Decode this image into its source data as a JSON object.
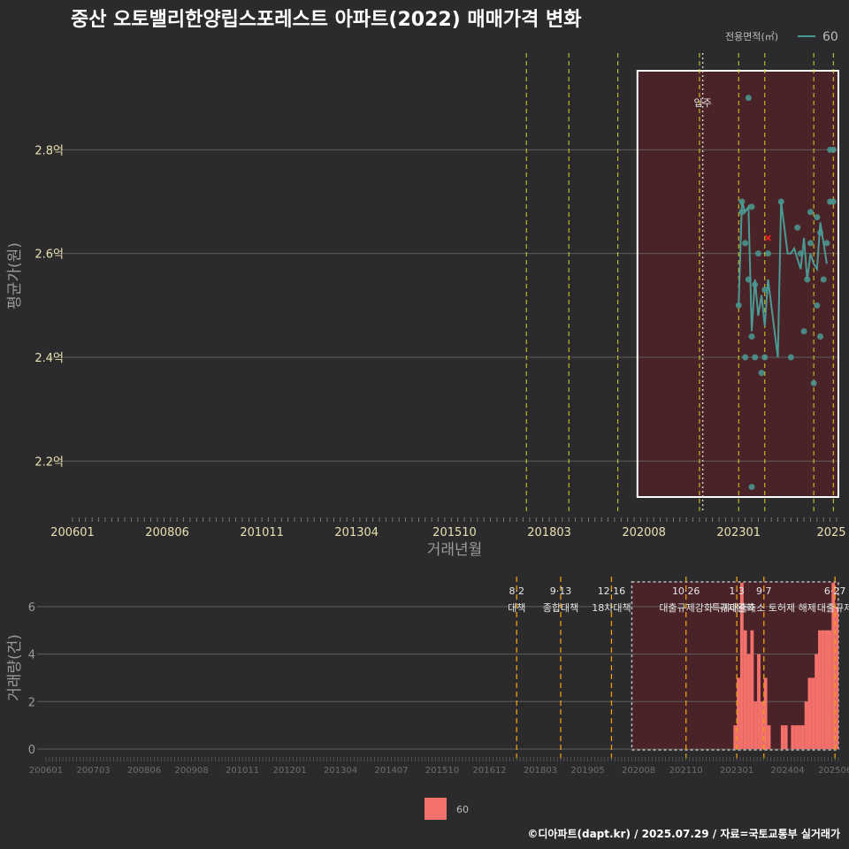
{
  "title": "중산 오토밸리한양립스포레스트 아파트(2022) 매매가격 변화",
  "caption": "©디아파트(dapt.kr) / 2025.07.29 / 자료=국토교통부 실거래가",
  "legend_top": {
    "title": "전용면적(㎡)",
    "label": "60",
    "color": "#4a9a94"
  },
  "legend_bottom": {
    "label": "60",
    "color": "#f4716b"
  },
  "colors": {
    "line": "#4a9a94",
    "bar": "#f4716b",
    "band": "#4a2328",
    "grid": "#5e5e5e",
    "vline": "#d8d820",
    "vline_bottom": "#e8a010",
    "box": "#ffffff",
    "mark": "#ff2020"
  },
  "chart_data": [
    {
      "type": "line",
      "title": "중산 오토밸리한양립스포레스트 아파트(2022) 매매가격 변화",
      "xlabel": "거래년월",
      "ylabel": "평균가(원)",
      "x_ticks": [
        "200601",
        "200806",
        "201011",
        "201304",
        "201510",
        "201803",
        "202008",
        "202301",
        "2025"
      ],
      "y_ticks": [
        {
          "v": 2.2,
          "label": "2.2억"
        },
        {
          "v": 2.4,
          "label": "2.4억"
        },
        {
          "v": 2.6,
          "label": "2.6억"
        },
        {
          "v": 2.8,
          "label": "2.8억"
        }
      ],
      "ylim": [
        2.1,
        3.0
      ],
      "xlim": [
        "2006-01",
        "2025-07"
      ],
      "highlight_box": [
        "2020-06",
        "2025-07"
      ],
      "move_in": {
        "x": "2022-02",
        "label": "입주"
      },
      "policy_lines": [
        "2017-08",
        "2018-09",
        "2019-12",
        "2022-01",
        "2023-01",
        "2023-09",
        "2024-12",
        "2025-06"
      ],
      "marker_x": {
        "x": "2023-10",
        "y": 2.63
      },
      "series": [
        {
          "name": "60",
          "line": [
            [
              "2023-01",
              2.5
            ],
            [
              "2023-02",
              2.7
            ],
            [
              "2023-03",
              2.68
            ],
            [
              "2023-04",
              2.69
            ],
            [
              "2023-05",
              2.45
            ],
            [
              "2023-06",
              2.55
            ],
            [
              "2023-07",
              2.48
            ],
            [
              "2023-08",
              2.52
            ],
            [
              "2023-09",
              2.46
            ],
            [
              "2023-10",
              2.55
            ],
            [
              "2023-11",
              2.5
            ],
            [
              "2023-12",
              2.45
            ],
            [
              "2024-01",
              2.4
            ],
            [
              "2024-02",
              2.7
            ],
            [
              "2024-04",
              2.6
            ],
            [
              "2024-05",
              2.6
            ],
            [
              "2024-06",
              2.61
            ],
            [
              "2024-07",
              2.59
            ],
            [
              "2024-08",
              2.57
            ],
            [
              "2024-09",
              2.63
            ],
            [
              "2024-10",
              2.55
            ],
            [
              "2024-11",
              2.6
            ],
            [
              "2024-12",
              2.58
            ],
            [
              "2025-01",
              2.57
            ],
            [
              "2025-02",
              2.66
            ],
            [
              "2025-03",
              2.62
            ],
            [
              "2025-04",
              2.58
            ]
          ],
          "points": [
            [
              "2023-01",
              2.5
            ],
            [
              "2023-02",
              2.7
            ],
            [
              "2023-02",
              2.68
            ],
            [
              "2023-03",
              2.62
            ],
            [
              "2023-03",
              2.4
            ],
            [
              "2023-04",
              2.9
            ],
            [
              "2023-04",
              2.55
            ],
            [
              "2023-05",
              2.69
            ],
            [
              "2023-05",
              2.15
            ],
            [
              "2023-05",
              2.44
            ],
            [
              "2023-06",
              2.4
            ],
            [
              "2023-06",
              2.54
            ],
            [
              "2023-07",
              2.6
            ],
            [
              "2023-08",
              2.37
            ],
            [
              "2023-09",
              2.4
            ],
            [
              "2023-09",
              2.53
            ],
            [
              "2023-10",
              2.6
            ],
            [
              "2024-02",
              2.7
            ],
            [
              "2024-05",
              2.4
            ],
            [
              "2024-07",
              2.65
            ],
            [
              "2024-08",
              2.6
            ],
            [
              "2024-09",
              2.45
            ],
            [
              "2024-10",
              2.55
            ],
            [
              "2024-11",
              2.62
            ],
            [
              "2024-11",
              2.68
            ],
            [
              "2024-12",
              2.35
            ],
            [
              "2025-01",
              2.67
            ],
            [
              "2025-01",
              2.5
            ],
            [
              "2025-02",
              2.64
            ],
            [
              "2025-02",
              2.44
            ],
            [
              "2025-03",
              2.55
            ],
            [
              "2025-04",
              2.62
            ],
            [
              "2025-05",
              2.8
            ],
            [
              "2025-05",
              2.7
            ],
            [
              "2025-06",
              2.7
            ],
            [
              "2025-06",
              2.8
            ]
          ]
        }
      ]
    },
    {
      "type": "bar",
      "xlabel": "",
      "ylabel": "거래량(건)",
      "x_ticks": [
        "200601",
        "200703",
        "200806",
        "200908",
        "201011",
        "201201",
        "201304",
        "201407",
        "201510",
        "201612",
        "201803",
        "201905",
        "202008",
        "202110",
        "202301",
        "202404",
        "202506"
      ],
      "y_ticks": [
        0,
        2,
        4,
        6
      ],
      "ylim": [
        0,
        7
      ],
      "highlight_box": [
        "2020-06",
        "2025-07"
      ],
      "events": [
        {
          "x": "2017-08",
          "date": "8·2",
          "label": "대책"
        },
        {
          "x": "2018-09",
          "date": "9·13",
          "label": "종합대책"
        },
        {
          "x": "2019-12",
          "date": "12·16",
          "label": "18차대책"
        },
        {
          "x": "2021-10",
          "date": "10·26",
          "label": "대출규제강화"
        },
        {
          "x": "2023-01",
          "date": "1·3",
          "label": "규제완화"
        },
        {
          "x": "2023-09",
          "date": "9·7",
          "label": "특례대출축소 토허제 해제"
        },
        {
          "x": "2025-06",
          "date": "6·27",
          "label": "대출규제"
        }
      ],
      "series": [
        {
          "name": "60",
          "bars": [
            [
              "2022-12",
              1
            ],
            [
              "2023-01",
              3
            ],
            [
              "2023-02",
              7
            ],
            [
              "2023-03",
              5
            ],
            [
              "2023-04",
              4
            ],
            [
              "2023-05",
              5
            ],
            [
              "2023-06",
              2
            ],
            [
              "2023-07",
              4
            ],
            [
              "2023-08",
              2
            ],
            [
              "2023-09",
              3
            ],
            [
              "2023-10",
              1
            ],
            [
              "2024-02",
              1
            ],
            [
              "2024-03",
              1
            ],
            [
              "2024-05",
              1
            ],
            [
              "2024-06",
              1
            ],
            [
              "2024-07",
              1
            ],
            [
              "2024-08",
              1
            ],
            [
              "2024-09",
              2
            ],
            [
              "2024-10",
              3
            ],
            [
              "2024-11",
              3
            ],
            [
              "2024-12",
              4
            ],
            [
              "2025-01",
              5
            ],
            [
              "2025-02",
              5
            ],
            [
              "2025-03",
              5
            ],
            [
              "2025-04",
              5
            ],
            [
              "2025-05",
              7
            ],
            [
              "2025-06",
              6
            ]
          ]
        }
      ]
    }
  ]
}
